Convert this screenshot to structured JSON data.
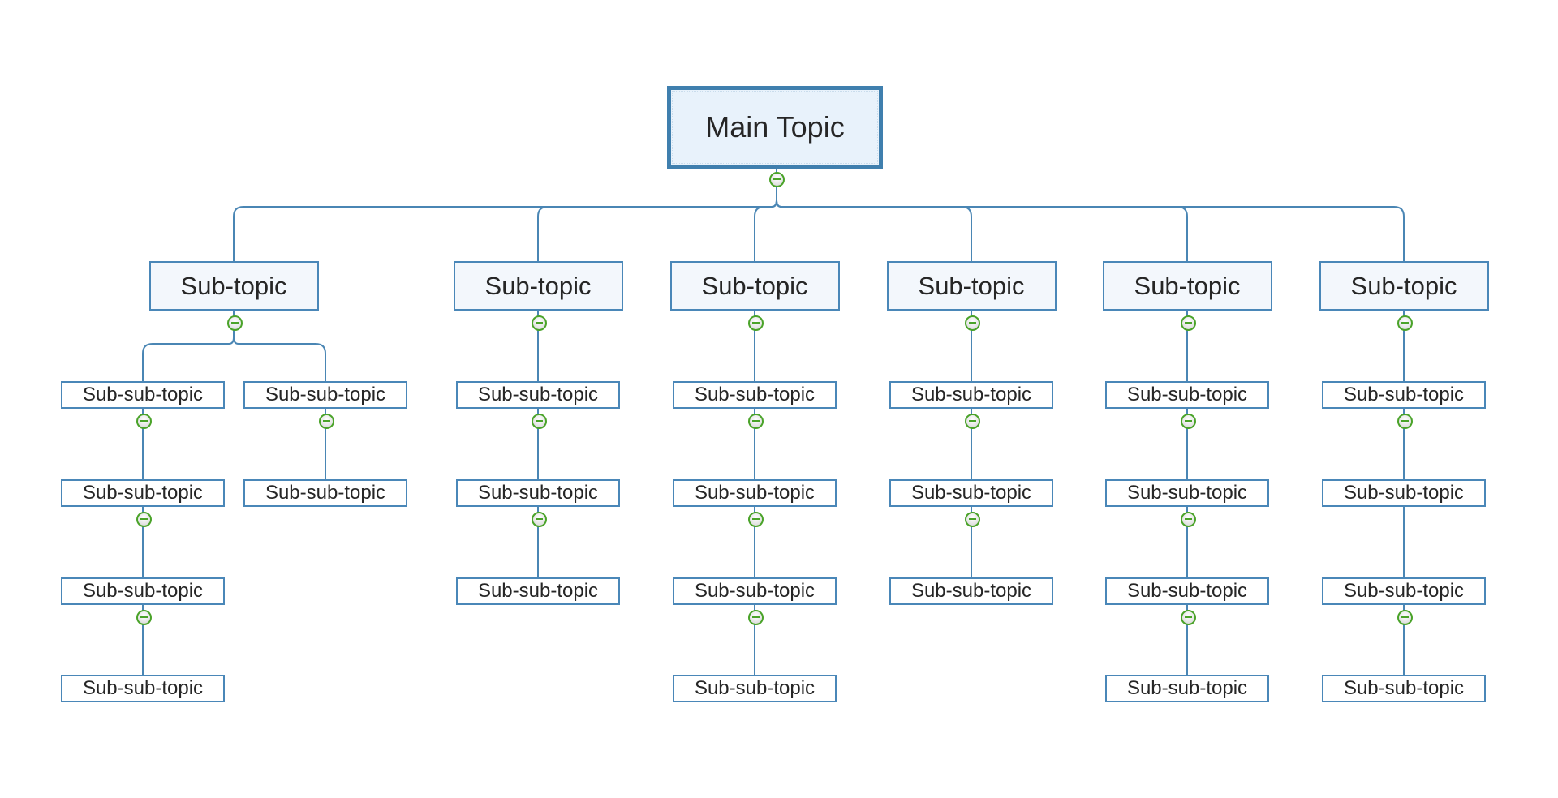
{
  "diagram": {
    "type": "mind-map-org-chart",
    "colors": {
      "line": "#4a86b4",
      "main_border": "#3f7fae",
      "main_fill": "#e8f2fb",
      "sub_border": "#4a87b8",
      "sub_fill": "#f3f7fc",
      "subsub_fill": "#ffffff",
      "collapse_icon": "#4aa329"
    },
    "main_topic": {
      "label": "Main Topic",
      "collapsible": true
    },
    "sub_topics": [
      {
        "label": "Sub-topic",
        "collapsible": true,
        "branches": [
          [
            {
              "label": "Sub-sub-topic",
              "collapsible": true
            },
            {
              "label": "Sub-sub-topic",
              "collapsible": true
            },
            {
              "label": "Sub-sub-topic",
              "collapsible": true
            },
            {
              "label": "Sub-sub-topic",
              "collapsible": false
            }
          ],
          [
            {
              "label": "Sub-sub-topic",
              "collapsible": true
            },
            {
              "label": "Sub-sub-topic",
              "collapsible": false
            }
          ]
        ]
      },
      {
        "label": "Sub-topic",
        "collapsible": true,
        "branches": [
          [
            {
              "label": "Sub-sub-topic",
              "collapsible": true
            },
            {
              "label": "Sub-sub-topic",
              "collapsible": true
            },
            {
              "label": "Sub-sub-topic",
              "collapsible": false
            }
          ]
        ]
      },
      {
        "label": "Sub-topic",
        "collapsible": true,
        "branches": [
          [
            {
              "label": "Sub-sub-topic",
              "collapsible": true
            },
            {
              "label": "Sub-sub-topic",
              "collapsible": true
            },
            {
              "label": "Sub-sub-topic",
              "collapsible": true
            },
            {
              "label": "Sub-sub-topic",
              "collapsible": false
            }
          ]
        ]
      },
      {
        "label": "Sub-topic",
        "collapsible": true,
        "branches": [
          [
            {
              "label": "Sub-sub-topic",
              "collapsible": true
            },
            {
              "label": "Sub-sub-topic",
              "collapsible": true
            },
            {
              "label": "Sub-sub-topic",
              "collapsible": false
            }
          ]
        ]
      },
      {
        "label": "Sub-topic",
        "collapsible": true,
        "branches": [
          [
            {
              "label": "Sub-sub-topic",
              "collapsible": true
            },
            {
              "label": "Sub-sub-topic",
              "collapsible": true
            },
            {
              "label": "Sub-sub-topic",
              "collapsible": true
            },
            {
              "label": "Sub-sub-topic",
              "collapsible": false
            }
          ]
        ]
      },
      {
        "label": "Sub-topic",
        "collapsible": true,
        "branches": [
          [
            {
              "label": "Sub-sub-topic",
              "collapsible": true
            },
            {
              "label": "Sub-sub-topic",
              "collapsible": false
            },
            {
              "label": "Sub-sub-topic",
              "collapsible": true
            },
            {
              "label": "Sub-sub-topic",
              "collapsible": false
            }
          ]
        ]
      }
    ]
  }
}
